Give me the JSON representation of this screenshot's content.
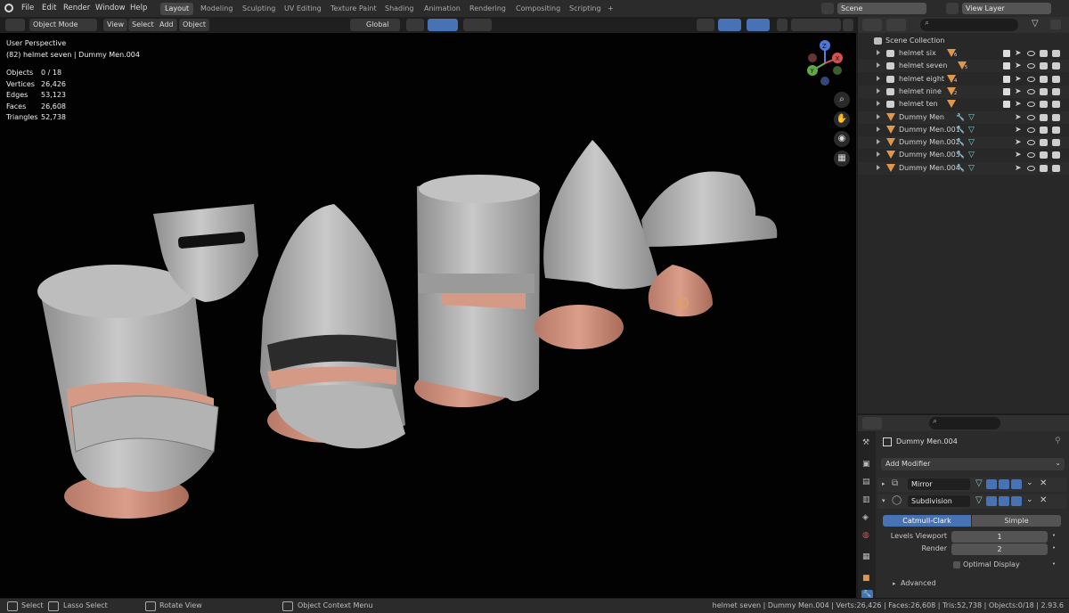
{
  "menu": [
    "File",
    "Edit",
    "Render",
    "Window",
    "Help"
  ],
  "workspaces": [
    "Layout",
    "Modeling",
    "Sculpting",
    "UV Editing",
    "Texture Paint",
    "Shading",
    "Animation",
    "Rendering",
    "Compositing",
    "Scripting"
  ],
  "workspace_add": "+",
  "scene_name": "Scene",
  "view_layer": "View Layer",
  "viewport_header": {
    "mode": "Object Mode",
    "menus": [
      "View",
      "Select",
      "Add",
      "Object"
    ],
    "orientation": "Global"
  },
  "viewport_info": {
    "perspective": "User Perspective",
    "active": "(82) helmet seven | Dummy Men.004"
  },
  "stats": [
    {
      "label": "Objects",
      "value": "0 / 18"
    },
    {
      "label": "Vertices",
      "value": "26,426"
    },
    {
      "label": "Edges",
      "value": "53,123"
    },
    {
      "label": "Faces",
      "value": "26,608"
    },
    {
      "label": "Triangles",
      "value": "52,738"
    }
  ],
  "gizmo": {
    "x": "X",
    "y": "Y",
    "z": "Z"
  },
  "outliner": {
    "root": "Scene Collection",
    "items": [
      {
        "name": "helmet six",
        "sub": "6"
      },
      {
        "name": "helmet seven",
        "sub": "5"
      },
      {
        "name": "helmet eight",
        "sub": "4"
      },
      {
        "name": "helmet nine",
        "sub": "2"
      },
      {
        "name": "helmet ten",
        "sub": ""
      },
      {
        "name": "Dummy Men",
        "sub": ""
      },
      {
        "name": "Dummy Men.001",
        "sub": ""
      },
      {
        "name": "Dummy Men.002",
        "sub": ""
      },
      {
        "name": "Dummy Men.003",
        "sub": ""
      },
      {
        "name": "Dummy Men.004",
        "sub": ""
      }
    ]
  },
  "properties": {
    "object_name": "Dummy Men.004",
    "add_modifier": "Add Modifier",
    "modifiers": [
      "Mirror",
      "Subdivision"
    ],
    "subdiv_types": [
      "Catmull-Clark",
      "Simple"
    ],
    "levels_viewport_label": "Levels Viewport",
    "levels_viewport_value": "1",
    "render_label": "Render",
    "render_value": "2",
    "optimal_display": "Optimal Display",
    "advanced": "Advanced"
  },
  "status": {
    "select": "Select",
    "lasso": "Lasso Select",
    "rotate": "Rotate View",
    "context": "Object Context Menu",
    "right": "helmet seven | Dummy Men.004 | Verts:26,426 | Faces:26,608 | Tris:52,738 | Objects:0/18 | 2.93.6"
  },
  "colors": {
    "accent_blue": "#4772b3",
    "orange_object": "#e1964c",
    "helmet_grey": "#b9b9b9",
    "skin": "#d49a86"
  }
}
